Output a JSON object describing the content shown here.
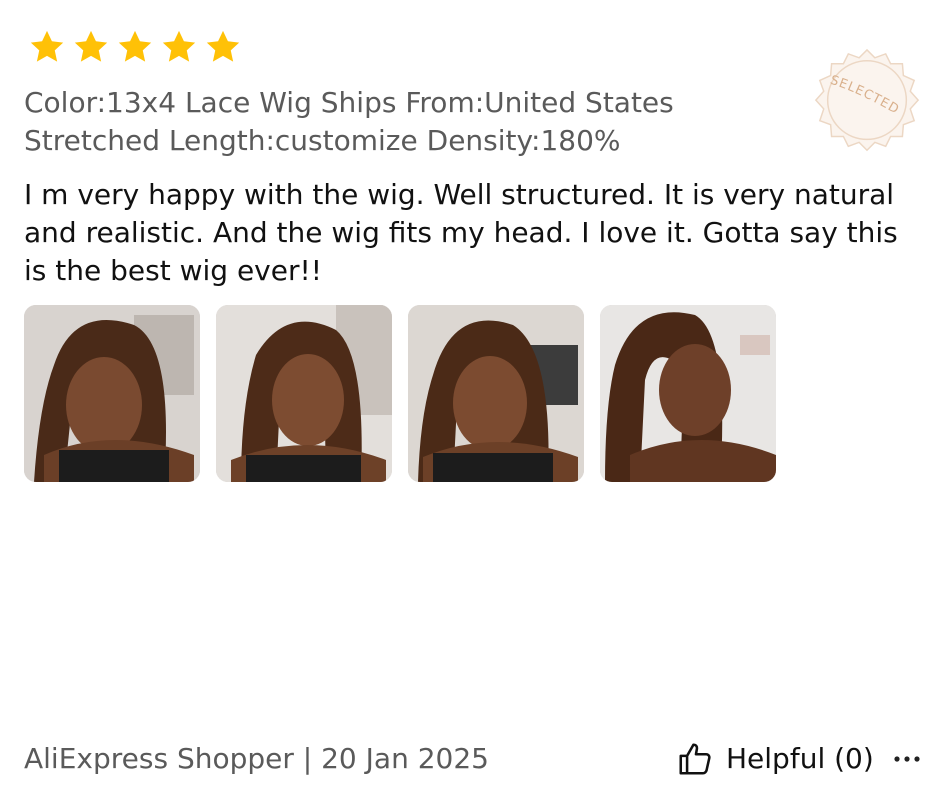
{
  "rating": {
    "stars": 5,
    "max": 5,
    "color": "#FFC107"
  },
  "badge": {
    "text": "SELECTED",
    "color": "#d9b08c"
  },
  "attributes": {
    "color": "Color:13x4 Lace Wig",
    "ships_from": "Ships From:United States",
    "stretched_length": "Stretched Length:customize",
    "density": "Density:180%"
  },
  "review": {
    "text": "I m very happy with the wig. Well structured. It is very natural and realistic. And the wig fits my head. I love it. Gotta say this is the best wig ever!!"
  },
  "photos": [
    {
      "icon": "review-photo"
    },
    {
      "icon": "review-photo"
    },
    {
      "icon": "review-photo"
    },
    {
      "icon": "review-photo"
    }
  ],
  "footer": {
    "author_date": "AliExpress Shopper | 20 Jan 2025",
    "helpful_label": "Helpful (0)",
    "helpful_icon": "thumbs-up-icon",
    "more_icon": "more-dots-icon"
  }
}
